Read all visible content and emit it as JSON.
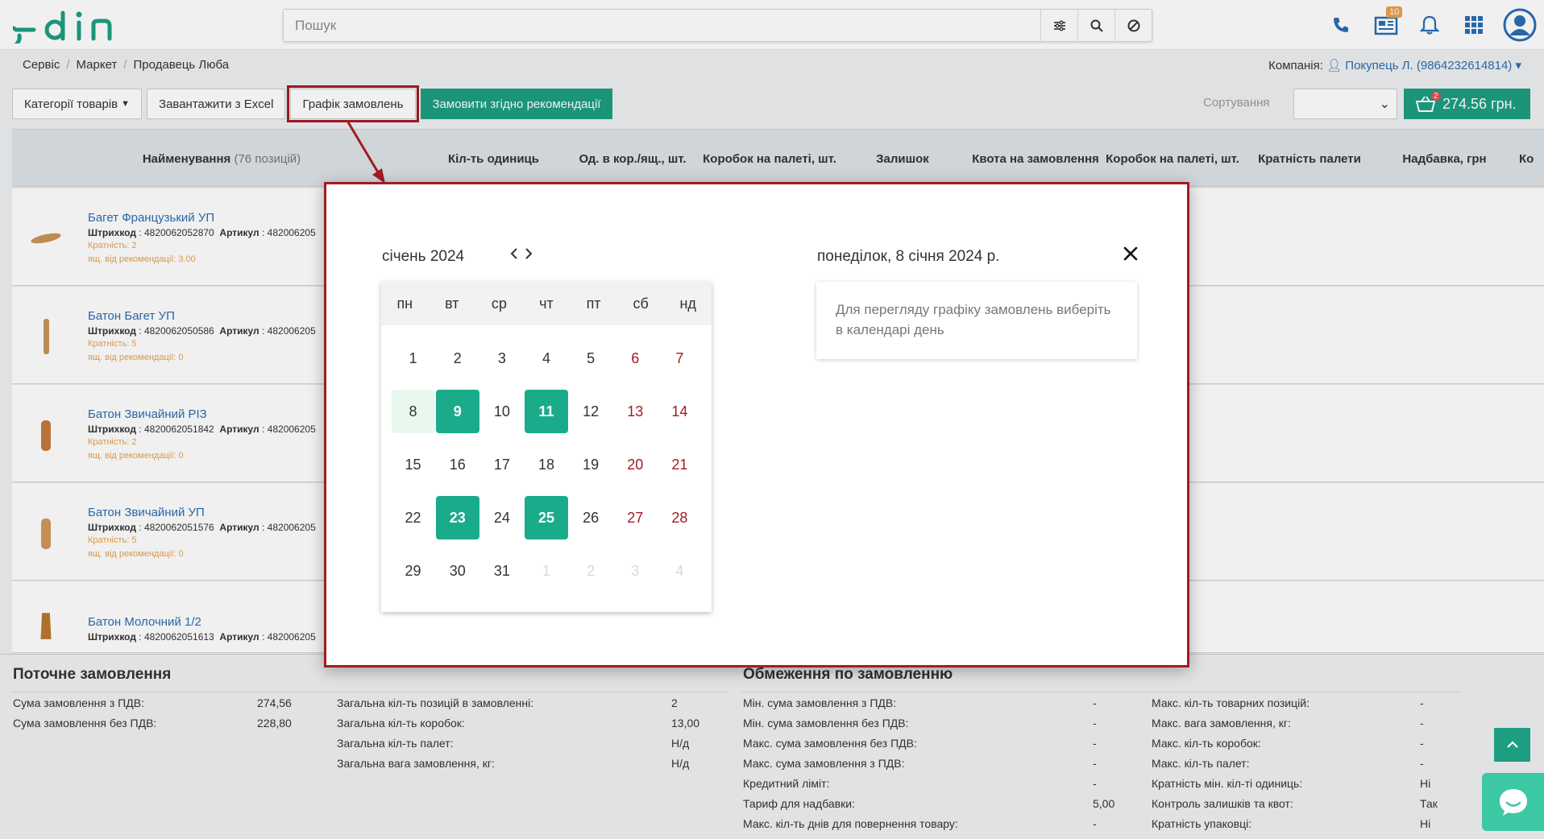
{
  "app": {
    "logo_text": "edin"
  },
  "search": {
    "placeholder": "Пошук"
  },
  "header": {
    "news_badge": "10"
  },
  "breadcrumbs": [
    "Сервіс",
    "Маркет",
    "Продавець Люба"
  ],
  "company": {
    "label": "Компанія:",
    "value": "Покупець Л. (9864232614814)"
  },
  "toolbar": {
    "categories_label": "Категорії товарів",
    "excel_label": "Завантажити з Excel",
    "schedule_label": "Графік замовлень",
    "recommend_label": "Замовити згідно рекомендації",
    "sort_label": "Сортування",
    "cart_count": "2",
    "cart_total": "274.56 грн."
  },
  "table": {
    "headers": {
      "name": "Найменування",
      "name_count": "(76 позицій)",
      "units": "Кіл-ть одиниць",
      "per_box": "Од. в кор./ящ., шт.",
      "boxes_pallet": "Коробок на палеті, шт.",
      "stock": "Залишок",
      "quota": "Квота на замовлення",
      "boxes_pallet2": "Коробок на палеті, шт.",
      "pallet_mult": "Кратність палети",
      "markup": "Надбавка, грн",
      "extra": "Ко"
    },
    "labels": {
      "barcode": "Штрихкод",
      "article": "Артикул",
      "multiplicity": "Кратність:",
      "recommend": "ящ. від рекомендації:"
    },
    "rows": [
      {
        "name": "Багет Французький УП",
        "barcode": "4820062052870",
        "article": "482006205",
        "multiplicity": "2",
        "recommend": "3.00"
      },
      {
        "name": "Батон Багет УП",
        "barcode": "4820062050586",
        "article": "482006205",
        "multiplicity": "5",
        "recommend": "0"
      },
      {
        "name": "Батон Звичайний РІЗ",
        "barcode": "4820062051842",
        "article": "482006205",
        "multiplicity": "2",
        "recommend": "0"
      },
      {
        "name": "Батон Звичайний УП",
        "barcode": "4820062051576",
        "article": "482006205",
        "multiplicity": "5",
        "recommend": "0"
      },
      {
        "name": "Батон Молочний 1/2",
        "barcode": "4820062051613",
        "article": "482006205",
        "multiplicity": "",
        "recommend": ""
      }
    ]
  },
  "footer": {
    "current_title": "Поточне замовлення",
    "sum_vat_label": "Сума замовлення з ПДВ:",
    "sum_vat": "274,56",
    "sum_novat_label": "Сума замовлення без ПДВ:",
    "sum_novat": "228,80",
    "positions_label": "Загальна кіл-ть позицій в замовленні:",
    "positions": "2",
    "boxes_label": "Загальна кіл-ть коробок:",
    "boxes": "13,00",
    "pallets_label": "Загальна кіл-ть палет:",
    "pallets": "Н/д",
    "weight_label": "Загальна вага замовлення, кг:",
    "weight": "Н/д",
    "limits_title": "Обмеження по замовленню",
    "min_vat_label": "Мін. сума замовлення з ПДВ:",
    "min_vat": "-",
    "min_novat_label": "Мін. сума замовлення без ПДВ:",
    "min_novat": "-",
    "max_novat_label": "Макс. сума замовлення без ПДВ:",
    "max_novat": "-",
    "max_vat_label": "Макс. сума замовлення з ПДВ:",
    "max_vat": "-",
    "credit_label": "Кредитний ліміт:",
    "credit": "-",
    "tariff_label": "Тариф для надбавки:",
    "tariff": "5,00",
    "return_days_label": "Макс. кіл-ть днів для повернення товару:",
    "return_days": "-",
    "max_items_label": "Макс. кіл-ть товарних позицій:",
    "max_items": "-",
    "max_weight_label": "Макс. вага замовлення, кг:",
    "max_weight": "-",
    "max_boxes_label": "Макс. кіл-ть коробок:",
    "max_boxes": "-",
    "max_pallets_label": "Макс. кіл-ть палет:",
    "max_pallets": "-",
    "min_qty_mult_label": "Кратність мін. кіл-ті одиниць:",
    "min_qty_mult": "Ні",
    "stock_control_label": "Контроль залишків та квот:",
    "stock_control": "Так",
    "pack_mult_label": "Кратність упаковці:",
    "pack_mult": "Ні"
  },
  "modal": {
    "month_title": "січень 2024",
    "weekdays": [
      "пн",
      "вт",
      "ср",
      "чт",
      "пт",
      "сб",
      "нд"
    ],
    "days": [
      "1",
      "2",
      "3",
      "4",
      "5",
      "6",
      "7",
      "8",
      "9",
      "10",
      "11",
      "12",
      "13",
      "14",
      "15",
      "16",
      "17",
      "18",
      "19",
      "20",
      "21",
      "22",
      "23",
      "24",
      "25",
      "26",
      "27",
      "28",
      "29",
      "30",
      "31",
      "1",
      "2",
      "3",
      "4"
    ],
    "selected_date_title": "понеділок, 8 січня 2024 р.",
    "hint": "Для перегляду графіку замовлень виберіть в календарі день"
  },
  "colors": {
    "accent": "#1d9e82",
    "calendar_active": "#1aab8a",
    "highlight": "#a31b22",
    "link": "#2a6db5"
  }
}
